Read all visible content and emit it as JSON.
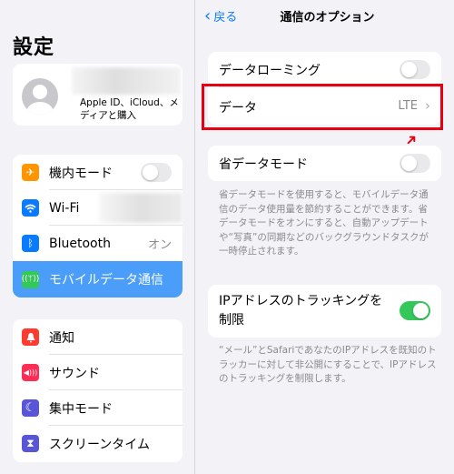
{
  "sidebar": {
    "title": "設定",
    "profile": {
      "subtitle": "Apple ID、iCloud、メディアと購入"
    },
    "group1": [
      {
        "label": "機内モード",
        "icon": "airplane-icon",
        "icon_color": "#ff9500",
        "glyph": "✈",
        "toggle": false
      },
      {
        "label": "Wi-Fi",
        "icon": "wifi-icon",
        "icon_color": "#0a7aff",
        "glyph": "≋"
      },
      {
        "label": "Bluetooth",
        "icon": "bluetooth-icon",
        "icon_color": "#0a7aff",
        "glyph": "ᛒ",
        "value": "オン"
      },
      {
        "label": "モバイルデータ通信",
        "icon": "antenna-icon",
        "icon_color": "#34c759",
        "glyph": "ꟷ",
        "selected": true
      }
    ],
    "group2": [
      {
        "label": "通知",
        "icon": "bell-icon",
        "icon_color": "#ff3b30",
        "glyph": "🔔"
      },
      {
        "label": "サウンド",
        "icon": "speaker-icon",
        "icon_color": "#ff2d55",
        "glyph": "◀"
      },
      {
        "label": "集中モード",
        "icon": "moon-icon",
        "icon_color": "#5856d6",
        "glyph": "☾"
      },
      {
        "label": "スクリーンタイム",
        "icon": "hourglass-icon",
        "icon_color": "#5856d6",
        "glyph": "⧗"
      }
    ]
  },
  "detail": {
    "back_label": "戻る",
    "title": "通信のオプション",
    "data_roaming": {
      "label": "データローミング",
      "on": false
    },
    "data": {
      "label": "データ",
      "value": "LTE"
    },
    "low_data": {
      "label": "省データモード",
      "on": false,
      "footer": "省データモードを使用すると、モバイルデータ通信のデータ使用量を節約することができます。省データモードをオンにすると、自動アップデートや“写真”の同期などのバックグラウンドタスクが一時停止されます。"
    },
    "ip_tracking": {
      "label": "IPアドレスのトラッキングを制限",
      "on": true,
      "footer": "“メール”とSafariであなたのIPアドレスを既知のトラッカーに対して非公開にすることで、IPアドレスのトラッキングを制限します。"
    }
  },
  "annotation": {
    "color": "#e60012"
  }
}
